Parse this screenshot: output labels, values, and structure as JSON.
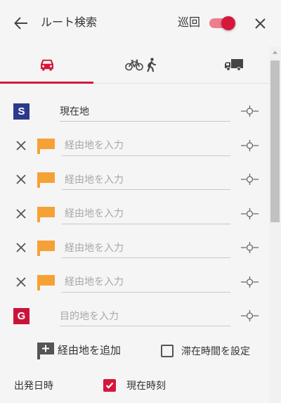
{
  "header": {
    "title": "ルート検索",
    "loop_label": "巡回",
    "loop_enabled": true
  },
  "tabs": [
    {
      "icon": "car-icon",
      "active": true
    },
    {
      "icon": "bicycle-icon",
      "icon2": "walking-icon",
      "active": false
    },
    {
      "icon": "truck-icon",
      "active": false
    }
  ],
  "route": {
    "start": {
      "badge": "S",
      "value": "現在地"
    },
    "waypoints": [
      {
        "placeholder": "経由地を入力",
        "value": ""
      },
      {
        "placeholder": "経由地を入力",
        "value": ""
      },
      {
        "placeholder": "経由地を入力",
        "value": ""
      },
      {
        "placeholder": "経由地を入力",
        "value": ""
      },
      {
        "placeholder": "経由地を入力",
        "value": ""
      }
    ],
    "goal": {
      "badge": "G",
      "placeholder": "目的地を入力",
      "value": ""
    }
  },
  "actions": {
    "add_waypoint_label": "経由地を追加",
    "stay_time_label": "滞在時間を設定",
    "stay_time_checked": false
  },
  "departure": {
    "label": "出発日時",
    "now_label": "現在時刻",
    "now_checked": true
  },
  "icons": {
    "back": "arrow-back-icon",
    "close": "close-icon",
    "delete": "remove-waypoint-icon",
    "waypoint": "flag-icon",
    "locate": "crosshair-icon",
    "add_waypoint": "add-flag-icon"
  },
  "colors": {
    "accent": "#d6173c",
    "start_badge": "#2d3a8c",
    "goal_badge": "#c9143a",
    "waypoint_flag": "#f6a135",
    "toggle_track": "#ee7d8e"
  }
}
